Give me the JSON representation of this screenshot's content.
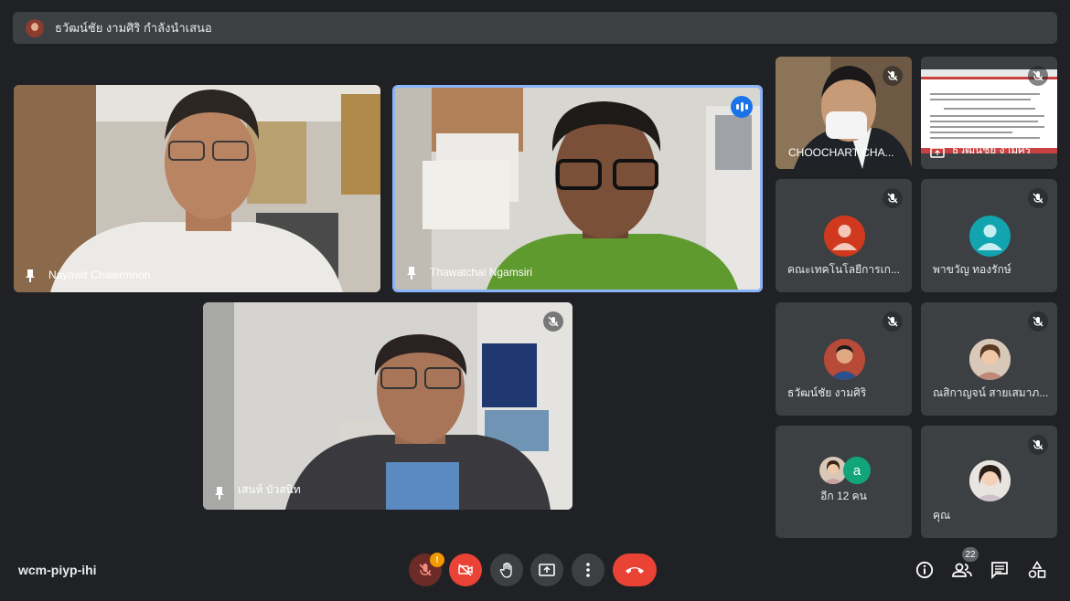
{
  "banner": {
    "presenting_text": "ธวัฒน์ชัย งามศิริ กำลังนำเสนอ"
  },
  "main_tiles": [
    {
      "name": "Nayawit Chalermnon"
    },
    {
      "name": "Thawatchai Ngamsiri"
    },
    {
      "name": "เสนห์ บัวสนิท"
    }
  ],
  "side_tiles": [
    {
      "name": "CHOOCHART CHA..."
    },
    {
      "name": "ธวัฒน์ชัย งามศิริ"
    },
    {
      "name": "คณะเทคโนโลยีการเก..."
    },
    {
      "name": "พาขวัญ ทองรักษ์"
    },
    {
      "name": "ธวัฒน์ชัย งามศิริ"
    },
    {
      "name": "ณสิกาญจน์ สายเสมาภ..."
    },
    {
      "name": "อีก 12 คน",
      "avatar_letter": "a"
    },
    {
      "name": "คุณ"
    }
  ],
  "meeting": {
    "code": "wcm-piyp-ihi"
  },
  "controls": {
    "mic_alert": "!",
    "people_count": "22"
  },
  "colors": {
    "speaking_border": "#8ab4f8",
    "end_call": "#ea4335",
    "mic_off": "#ea4335"
  }
}
